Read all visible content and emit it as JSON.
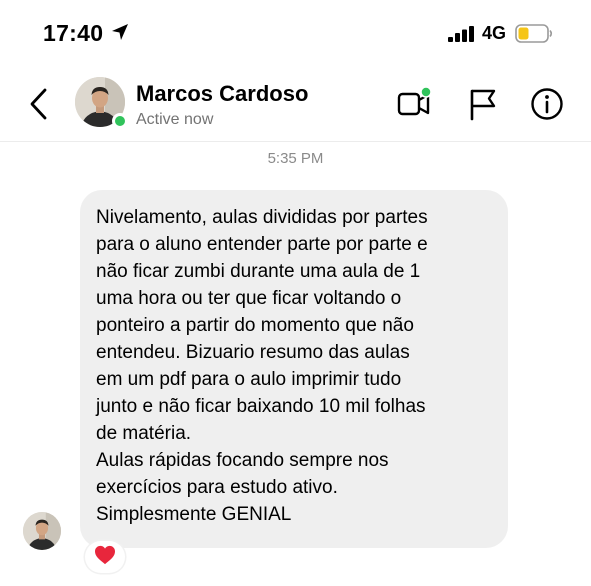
{
  "status_bar": {
    "time": "17:40",
    "network": "4G",
    "icons": [
      "location-arrow-icon",
      "signal-bars-icon",
      "battery-icon"
    ],
    "battery_color": "#f5c518"
  },
  "header": {
    "contact_name": "Marcos Cardoso",
    "contact_status": "Active now",
    "online_color": "#30c35b",
    "icons": [
      "chevron-left-icon",
      "video-call-icon",
      "flag-icon",
      "info-icon"
    ]
  },
  "conversation": {
    "timestamp": "5:35 PM",
    "message": {
      "paragraph_1": "Nivelamento, aulas divididas por partes\npara o aluno entender parte por parte e\nnão ficar zumbi durante uma aula de 1\numa hora ou ter que ficar voltando o\nponteiro a partir do momento que não\nentendeu. Bizuario resumo das aulas\nem um pdf para o aulo imprimir tudo\njunto e não ficar baixando 10 mil folhas\nde matéria.",
      "paragraph_2": "Aulas rápidas focando sempre nos\nexercícios para estudo ativo.\nSimplesmente GENIAL"
    },
    "reaction": "heart-icon",
    "reaction_color": "#e8263c"
  }
}
